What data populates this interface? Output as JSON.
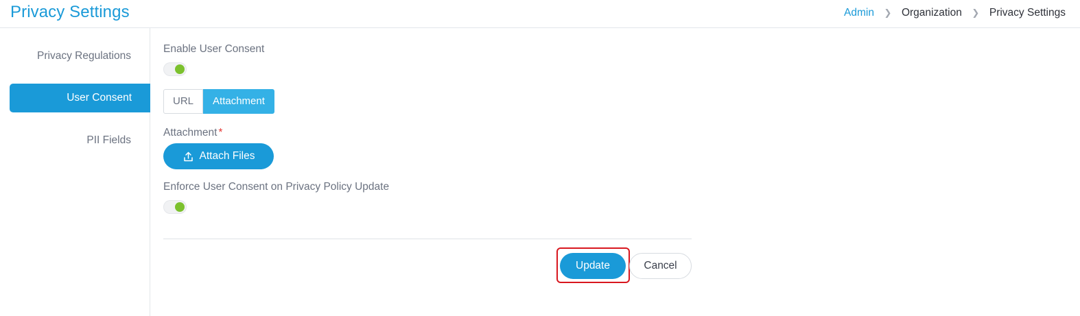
{
  "header": {
    "title": "Privacy Settings",
    "breadcrumb": [
      "Admin",
      "Organization",
      "Privacy Settings"
    ]
  },
  "sidebar": {
    "items": [
      {
        "label": "Privacy Regulations",
        "active": false
      },
      {
        "label": "User Consent",
        "active": true
      },
      {
        "label": "PII Fields",
        "active": false
      }
    ]
  },
  "form": {
    "enable_user_consent": {
      "label": "Enable User Consent",
      "enabled": true
    },
    "source_tabs": [
      {
        "label": "URL",
        "selected": false
      },
      {
        "label": "Attachment",
        "selected": true
      }
    ],
    "attachment": {
      "label": "Attachment",
      "required_mark": "*",
      "button_label": "Attach Files",
      "icon": "upload-icon"
    },
    "enforce_consent": {
      "label": "Enforce User Consent on Privacy Policy Update",
      "enabled": true
    }
  },
  "actions": {
    "update_label": "Update",
    "cancel_label": "Cancel"
  },
  "colors": {
    "primary": "#1a9ad8",
    "toggle_on": "#7cc12e",
    "highlight": "#d8161e",
    "required": "#e53935"
  }
}
